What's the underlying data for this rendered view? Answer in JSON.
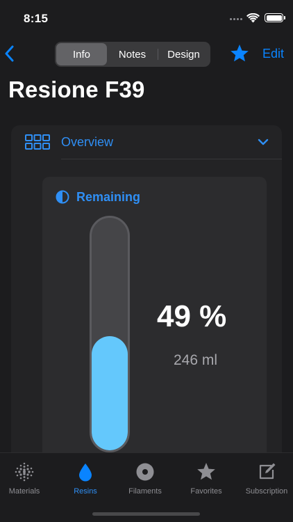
{
  "status_bar": {
    "time": "8:15"
  },
  "nav": {
    "segments": [
      {
        "label": "Info",
        "selected": true
      },
      {
        "label": "Notes",
        "selected": false
      },
      {
        "label": "Design",
        "selected": false
      }
    ],
    "edit_label": "Edit",
    "favorite_icon": "star-icon"
  },
  "page_title": "Resione F39",
  "overview": {
    "label": "Overview",
    "icon": "grid-icon",
    "expanded": true
  },
  "remaining": {
    "label": "Remaining",
    "percent_text": "49 %",
    "fill_fraction": 0.49,
    "volume_text": "246 ml"
  },
  "tabs": [
    {
      "label": "Materials",
      "icon": "materials-grid-icon",
      "active": false
    },
    {
      "label": "Resins",
      "icon": "drop-icon",
      "active": true
    },
    {
      "label": "Filaments",
      "icon": "spool-icon",
      "active": false
    },
    {
      "label": "Favorites",
      "icon": "star-icon",
      "active": false
    },
    {
      "label": "Subscription",
      "icon": "edit-square-icon",
      "active": false
    }
  ],
  "colors": {
    "accent": "#0a84ff",
    "label_blue": "#2f8ff5",
    "resin_fill": "#64c8fc",
    "background": "#1c1c1e"
  }
}
